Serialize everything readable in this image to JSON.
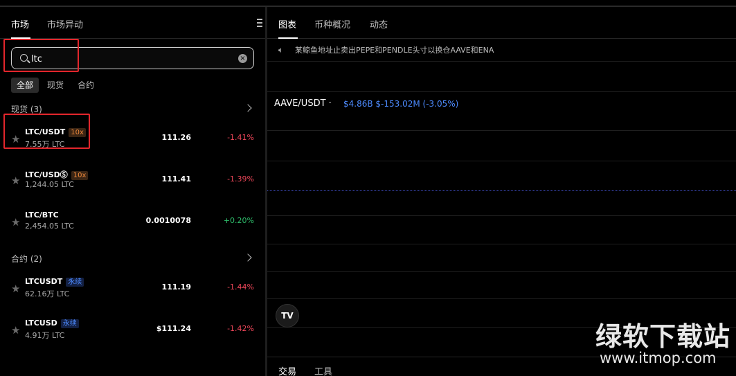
{
  "left_panel": {
    "tabs": [
      {
        "label": "市场"
      },
      {
        "label": "市场异动"
      }
    ],
    "search": {
      "value": "ltc",
      "placeholder": ""
    },
    "filters": [
      {
        "label": "全部"
      },
      {
        "label": "现货"
      },
      {
        "label": "合约"
      }
    ],
    "spot_section": {
      "label": "现货 (3)"
    },
    "futures_section": {
      "label": "合约 (2)"
    },
    "spot_rows": [
      {
        "symbol": "LTC/USDT",
        "badge": "10x",
        "volume": "7.55万 LTC",
        "price": "111.26",
        "change": "-1.41%",
        "direction": "down"
      },
      {
        "symbol": "LTC/USDⓈ",
        "badge": "10x",
        "volume": "1,244.05 LTC",
        "price": "111.41",
        "change": "-1.39%",
        "direction": "down"
      },
      {
        "symbol": "LTC/BTC",
        "badge": "",
        "volume": "2,454.05 LTC",
        "price": "0.0010078",
        "change": "+0.20%",
        "direction": "up"
      }
    ],
    "futures_rows": [
      {
        "symbol": "LTCUSDT",
        "badge": "永续",
        "volume": "62.16万 LTC",
        "price": "111.19",
        "change": "-1.44%",
        "direction": "down"
      },
      {
        "symbol": "LTCUSD",
        "badge": "永续",
        "volume": "4.91万 LTC",
        "price": "$111.24",
        "change": "-1.42%",
        "direction": "down"
      }
    ]
  },
  "right_panel": {
    "tabs": [
      {
        "label": "图表"
      },
      {
        "label": "币种概况"
      },
      {
        "label": "动态"
      }
    ],
    "news": "某鲸鱼地址止卖出PEPE和PENDLE头寸以换仓AAVE和ENA",
    "chart_title": "AAVE/USDT ·",
    "chart_stats": "$4.86B  $-153.02M (-3.05%)",
    "tv_logo": "TV",
    "bottom_tabs": [
      {
        "label": "交易"
      },
      {
        "label": "工具"
      }
    ]
  },
  "watermark": {
    "cn": "绿软下载站",
    "en": "www.itmop.com"
  },
  "colors": {
    "negative": "#f0475a",
    "positive": "#2ebd6b",
    "accent_blue": "#4d8bff",
    "highlight_red": "#e3262c"
  }
}
